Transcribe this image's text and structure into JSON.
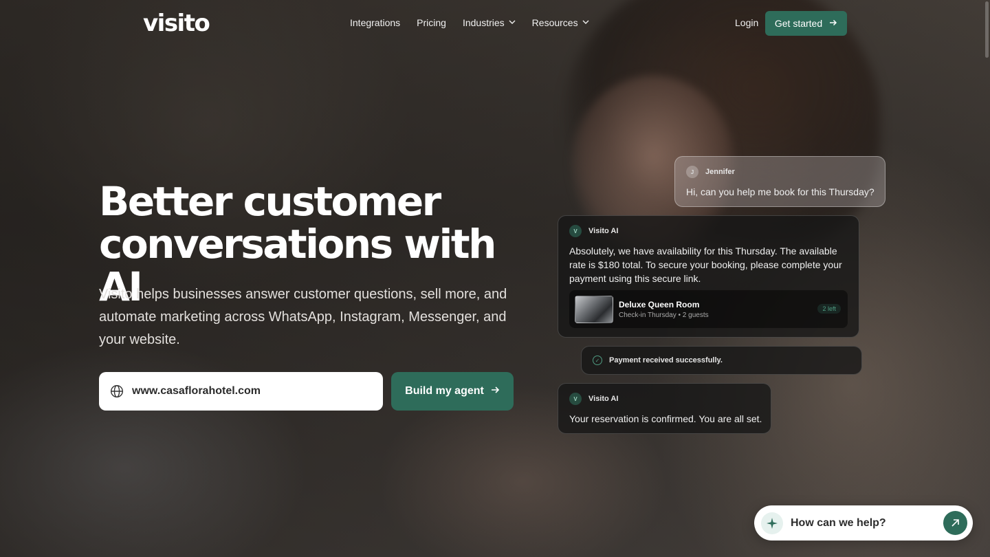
{
  "nav": {
    "logo": "visito",
    "links": [
      {
        "label": "Integrations",
        "has_dropdown": false
      },
      {
        "label": "Pricing",
        "has_dropdown": false
      },
      {
        "label": "Industries",
        "has_dropdown": true
      },
      {
        "label": "Resources",
        "has_dropdown": true
      }
    ],
    "login_label": "Login",
    "get_started_label": "Get started"
  },
  "hero": {
    "title_line1": "Better customer",
    "title_line2": "conversations with AI",
    "subtitle": "Visito helps businesses answer customer questions, sell more, and automate marketing across WhatsApp, Instagram, Messenger, and your website.",
    "url_input_value": "www.casaflorahotel.com",
    "build_button_label": "Build my agent"
  },
  "chat": {
    "user_message": {
      "avatar": "J",
      "sender": "Jennifer",
      "text": "Hi, can you help me book for this Thursday?"
    },
    "ai_message_1": {
      "avatar": "V",
      "sender": "Visito AI",
      "text": "Absolutely, we have availability for this Thursday. The available rate is $180 total. To secure your booking, please complete your payment using this secure link.",
      "room": {
        "name": "Deluxe Queen Room",
        "meta": "Check-in Thursday • 2 guests",
        "badge": "2 left"
      }
    },
    "payment_status": "Payment received successfully.",
    "ai_message_2": {
      "avatar": "V",
      "sender": "Visito AI",
      "text": "Your reservation is confirmed. You are all set."
    }
  },
  "help_widget": {
    "label": "How can we help?"
  },
  "colors": {
    "brand_green": "#2e6c5a",
    "accent_green": "#4f9c82"
  }
}
